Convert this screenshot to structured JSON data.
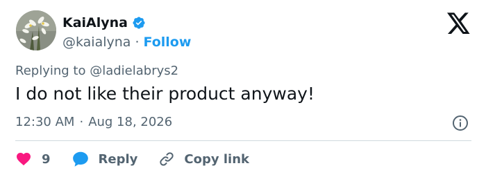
{
  "tweet": {
    "author": {
      "display_name": "KaiAlyna",
      "handle": "@kaialyna",
      "separator": "·",
      "follow_label": "Follow",
      "verified": true
    },
    "reply_prefix": "Replying to",
    "reply_to_handle": "@ladielabrys2",
    "text": "I do not like their product anyway!",
    "time": "12:30 AM",
    "time_separator": "·",
    "date": "Aug 18, 2026",
    "like_count": "9",
    "reply_label": "Reply",
    "copy_link_label": "Copy link"
  },
  "colors": {
    "accent": "#1d9bf0",
    "like": "#f91880",
    "text_primary": "#0f1419",
    "text_secondary": "#536471",
    "divider": "#cfd9de"
  },
  "icons": {
    "logo": "x-logo-icon",
    "verified": "verified-badge-icon",
    "info": "info-icon",
    "like": "heart-icon",
    "reply": "speech-bubble-icon",
    "copy": "link-icon"
  }
}
